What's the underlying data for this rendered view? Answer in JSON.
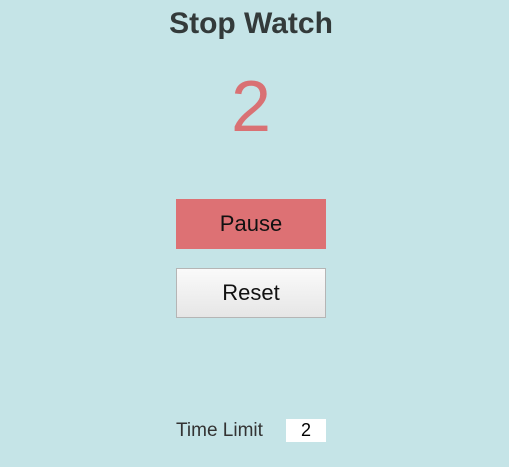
{
  "app": {
    "title": "Stop Watch"
  },
  "timer": {
    "count": "2"
  },
  "controls": {
    "pause_label": "Pause",
    "reset_label": "Reset"
  },
  "time_limit": {
    "label": "Time Limit",
    "value": "2"
  },
  "colors": {
    "background": "#c5e4e7",
    "accent": "#dd7174",
    "count_text": "#d97174",
    "title_text": "#333a3a"
  }
}
